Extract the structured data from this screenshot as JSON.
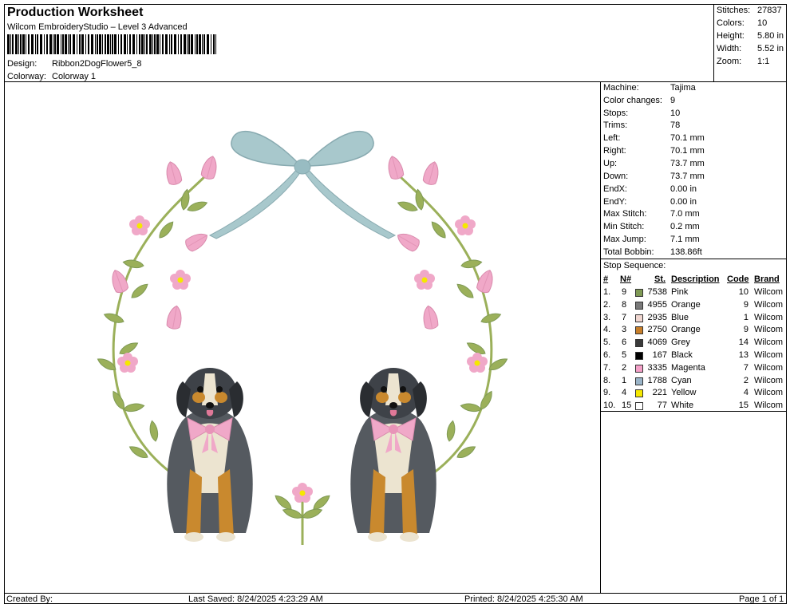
{
  "header": {
    "title": "Production Worksheet",
    "subtitle": "Wilcom EmbroideryStudio – Level 3 Advanced",
    "design_label": "Design:",
    "design_value": "Ribbon2DogFlower5_8",
    "colorway_label": "Colorway:",
    "colorway_value": "Colorway 1"
  },
  "stats": [
    {
      "label": "Stitches:",
      "value": "27837"
    },
    {
      "label": "Colors:",
      "value": "10"
    },
    {
      "label": "Height:",
      "value": "5.80 in"
    },
    {
      "label": "Width:",
      "value": "5.52 in"
    },
    {
      "label": "Zoom:",
      "value": "1:1"
    }
  ],
  "info": [
    {
      "label": "Machine:",
      "value": "Tajima"
    },
    {
      "label": "Color changes:",
      "value": "9"
    },
    {
      "label": "Stops:",
      "value": "10"
    },
    {
      "label": "Trims:",
      "value": "78"
    },
    {
      "label": "Left:",
      "value": "70.1 mm"
    },
    {
      "label": "Right:",
      "value": "70.1 mm"
    },
    {
      "label": "Up:",
      "value": "73.7 mm"
    },
    {
      "label": "Down:",
      "value": "73.7 mm"
    },
    {
      "label": "EndX:",
      "value": "0.00 in"
    },
    {
      "label": "EndY:",
      "value": "0.00 in"
    },
    {
      "label": "Max Stitch:",
      "value": "7.0 mm"
    },
    {
      "label": "Min Stitch:",
      "value": "0.2 mm"
    },
    {
      "label": "Max Jump:",
      "value": "7.1 mm"
    },
    {
      "label": "Total Bobbin:",
      "value": "138.86ft"
    }
  ],
  "stop_sequence": {
    "title": "Stop Sequence:",
    "headers": {
      "num": "#",
      "n": "N#",
      "st": "St.",
      "desc": "Description",
      "code": "Code",
      "brand": "Brand"
    },
    "rows": [
      {
        "num": "1.",
        "n": "9",
        "color": "#7f9a55",
        "st": "7538",
        "desc": "Pink",
        "code": "10",
        "brand": "Wilcom"
      },
      {
        "num": "2.",
        "n": "8",
        "color": "#7a7a7a",
        "st": "4955",
        "desc": "Orange",
        "code": "9",
        "brand": "Wilcom"
      },
      {
        "num": "3.",
        "n": "7",
        "color": "#f0d6d0",
        "st": "2935",
        "desc": "Blue",
        "code": "1",
        "brand": "Wilcom"
      },
      {
        "num": "4.",
        "n": "3",
        "color": "#c87f2a",
        "st": "2750",
        "desc": "Orange",
        "code": "9",
        "brand": "Wilcom"
      },
      {
        "num": "5.",
        "n": "6",
        "color": "#3a3a3a",
        "st": "4069",
        "desc": "Grey",
        "code": "14",
        "brand": "Wilcom"
      },
      {
        "num": "6.",
        "n": "5",
        "color": "#000000",
        "st": "167",
        "desc": "Black",
        "code": "13",
        "brand": "Wilcom"
      },
      {
        "num": "7.",
        "n": "2",
        "color": "#f4a0c8",
        "st": "3335",
        "desc": "Magenta",
        "code": "7",
        "brand": "Wilcom"
      },
      {
        "num": "8.",
        "n": "1",
        "color": "#9ab4c8",
        "st": "1788",
        "desc": "Cyan",
        "code": "2",
        "brand": "Wilcom"
      },
      {
        "num": "9.",
        "n": "4",
        "color": "#f5e800",
        "st": "221",
        "desc": "Yellow",
        "code": "4",
        "brand": "Wilcom"
      },
      {
        "num": "10.",
        "n": "15",
        "color": "#ffffff",
        "st": "77",
        "desc": "White",
        "code": "15",
        "brand": "Wilcom"
      }
    ]
  },
  "footer": {
    "created": "Created By:",
    "saved": "Last Saved: 8/24/2025 4:23:29 AM",
    "printed": "Printed: 8/24/2025 4:25:30 AM",
    "page": "Page 1 of 1"
  },
  "colors": {
    "leaf": "#9bb05a",
    "leaf_dark": "#7f9a55",
    "tulip": "#f0a8c8",
    "ribbon": "#a8c8cc",
    "flower_center": "#f5e800",
    "dog_grey": "#555a60",
    "dog_tan": "#c9892e",
    "dog_cream": "#ece4d0"
  }
}
